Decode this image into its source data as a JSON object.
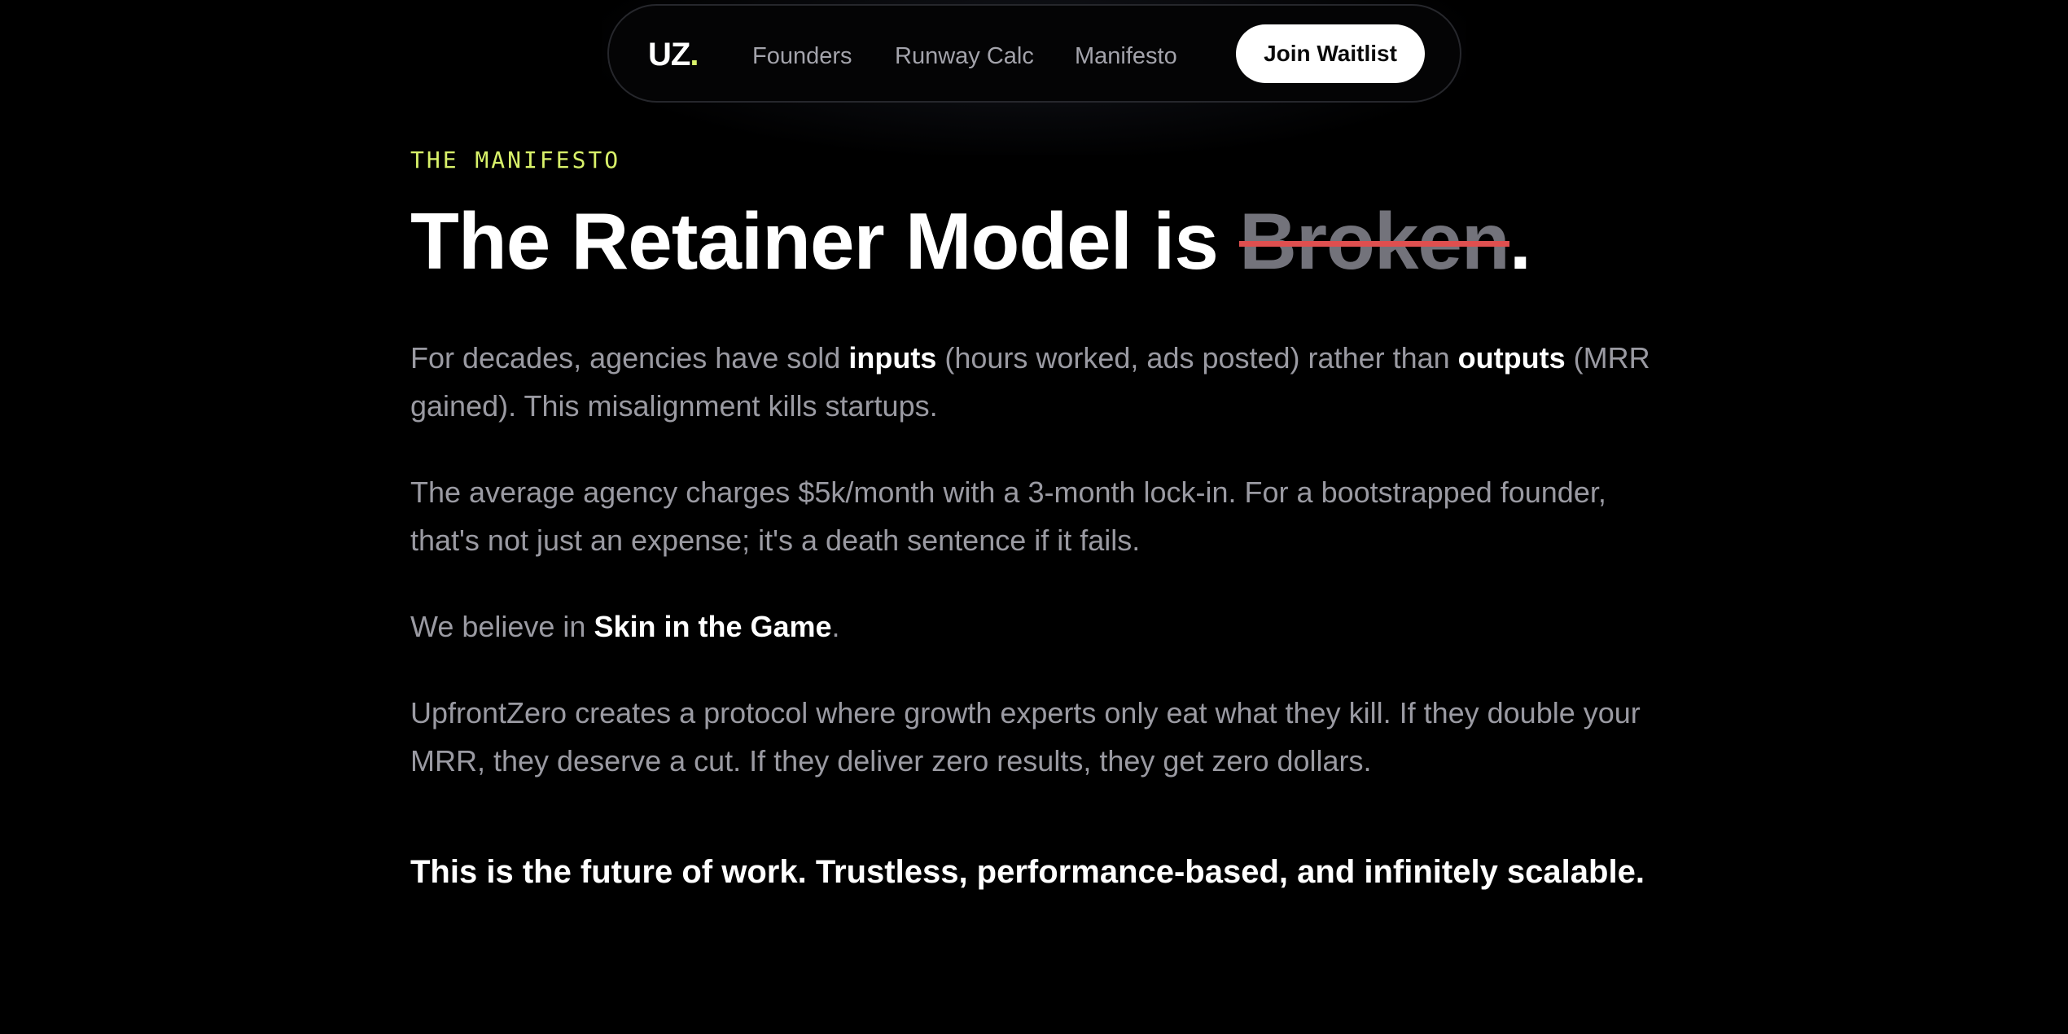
{
  "nav": {
    "logo_text": "UZ",
    "logo_dot": ".",
    "links": [
      "Founders",
      "Runway Calc",
      "Manifesto"
    ],
    "cta_label": "Join Waitlist"
  },
  "hero": {
    "eyebrow": "THE MANIFESTO",
    "headline_prefix": "The Retainer Model is ",
    "headline_struck": "Broken",
    "headline_suffix": "."
  },
  "paragraphs": {
    "p1": {
      "part1": "For decades, agencies have sold ",
      "bold1": "inputs",
      "part2": " (hours worked, ads posted) rather than ",
      "bold2": "outputs",
      "part3": " (MRR gained). This misalignment kills startups."
    },
    "p2": {
      "text": "The average agency charges $5k/month with a 3-month lock-in. For a bootstrapped founder, that's not just an expense; it's a death sentence if it fails."
    },
    "p3": {
      "part1": "We believe in ",
      "bold1": "Skin in the Game",
      "part2": "."
    },
    "p4": {
      "text": "UpfrontZero creates a protocol where growth experts only eat what they kill. If they double your MRR, they deserve a cut. If they deliver zero results, they get zero dollars."
    },
    "closing": "This is the future of work. Trustless, performance-based, and infinitely scalable."
  },
  "colors": {
    "background": "#000000",
    "accent": "#d9f26a",
    "strike": "#df4f4f",
    "muted_text": "#9a9aa2"
  }
}
